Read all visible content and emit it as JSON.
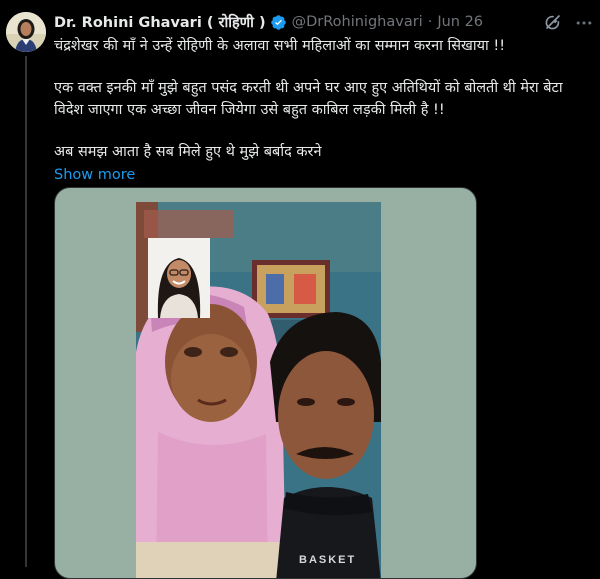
{
  "tweet": {
    "author": {
      "display_name": "Dr. Rohini Ghavari ( रोहिणी )",
      "handle": "@DrRohinighavari",
      "date": "Jun 26",
      "verified": true
    },
    "separator": "·",
    "text_lines": [
      "चंद्रशेखर की माँ ने उन्हें रोहिणी के अलावा सभी महिलाओं का सम्मान करना सिखाया !!",
      "एक वक्त इनकी माँ मुझे बहुत पसंद करती थी अपने घर आए हुए अतिथियों को बोलती थी मेरा बेटा विदेश जाएगा एक अच्छा जीवन जियेगा उसे बहुत काबिल लड़की मिली है !!",
      "अब समझ आता है सब मिले हुए थे मुझे बर्बाद करने"
    ],
    "show_more_label": "Show more",
    "media": {
      "overlay_text": "BASKET"
    }
  },
  "icons": {
    "verified": "verified-badge-icon",
    "grok": "grok-icon",
    "more": "more-options-icon"
  },
  "colors": {
    "background": "#000000",
    "text_primary": "#e7e9ea",
    "text_secondary": "#71767b",
    "link": "#1d9bf0",
    "verified": "#1d9bf0"
  }
}
